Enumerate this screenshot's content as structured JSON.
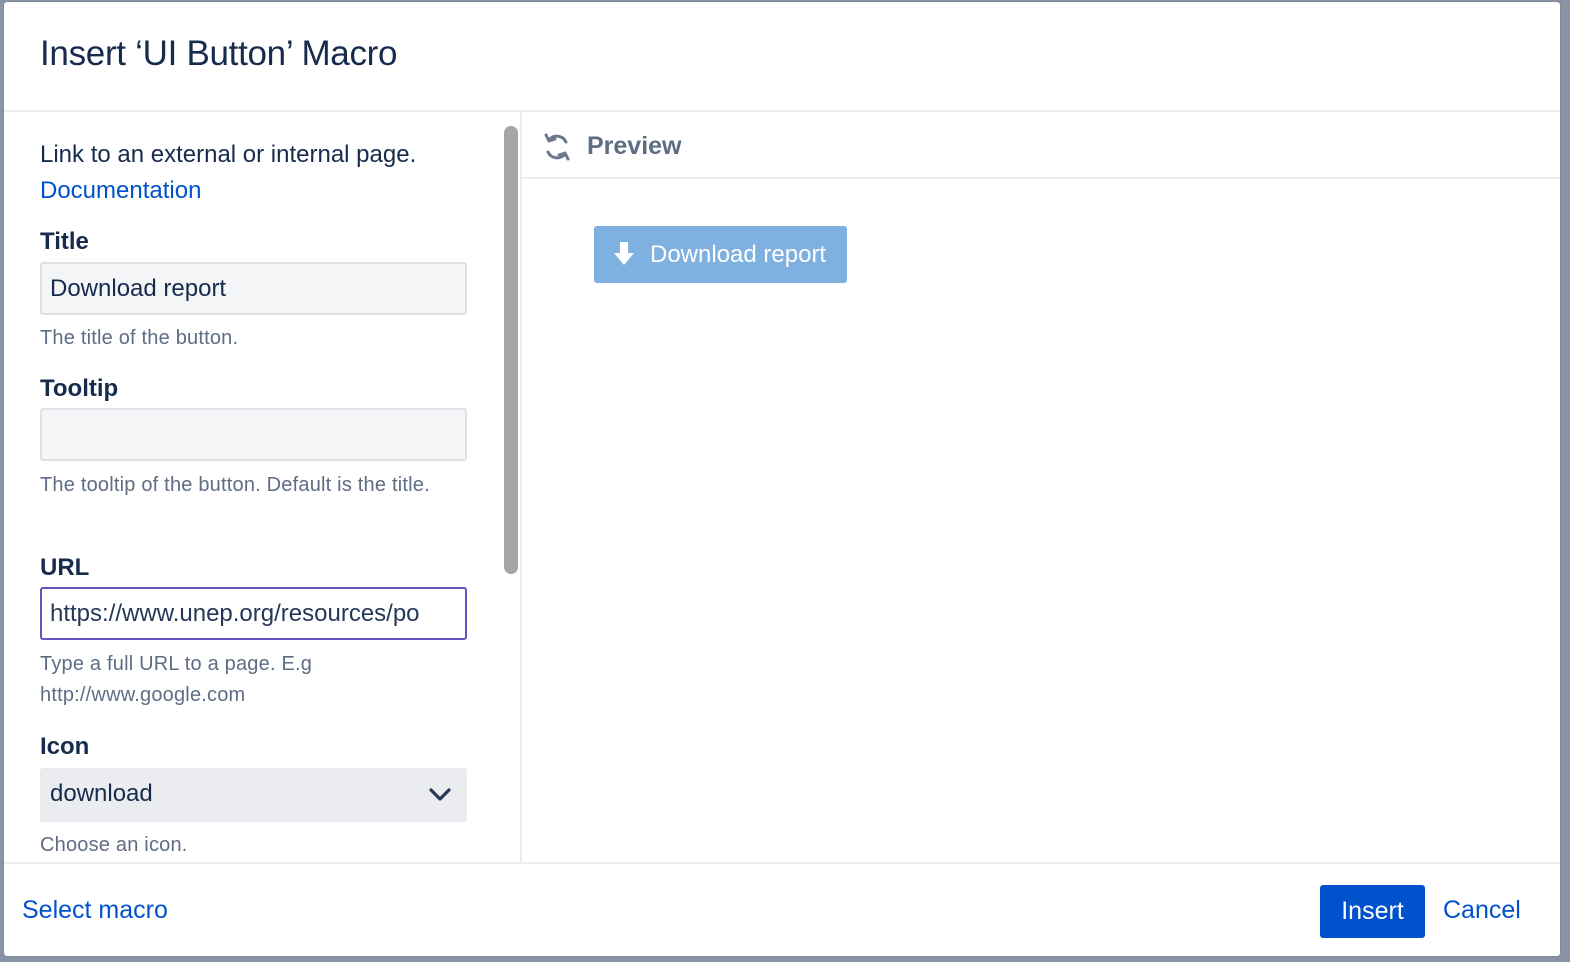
{
  "dialog": {
    "title": "Insert ‘UI Button’ Macro"
  },
  "form": {
    "description": "Link to an external or internal page.",
    "doc_link": "Documentation",
    "fields": {
      "title": {
        "label": "Title",
        "value": "Download report",
        "help": "The title of the button."
      },
      "tooltip": {
        "label": "Tooltip",
        "value": "",
        "help": "The tooltip of the button. Default is the title."
      },
      "url": {
        "label": "URL",
        "value": "https://www.unep.org/resources/po",
        "help": "Type a full URL to a page. E.g http://www.google.com"
      },
      "icon": {
        "label": "Icon",
        "value": "download",
        "help": "Choose an icon."
      }
    }
  },
  "preview": {
    "title": "Preview",
    "button_label": "Download report",
    "button_icon": "arrow-down-icon",
    "button_color": "#7eb0e0"
  },
  "footer": {
    "select_macro": "Select macro",
    "insert": "Insert",
    "cancel": "Cancel"
  },
  "colors": {
    "primary": "#0052cc",
    "text": "#172b4d",
    "muted": "#5e6c84",
    "focus_border": "#6554c0"
  }
}
